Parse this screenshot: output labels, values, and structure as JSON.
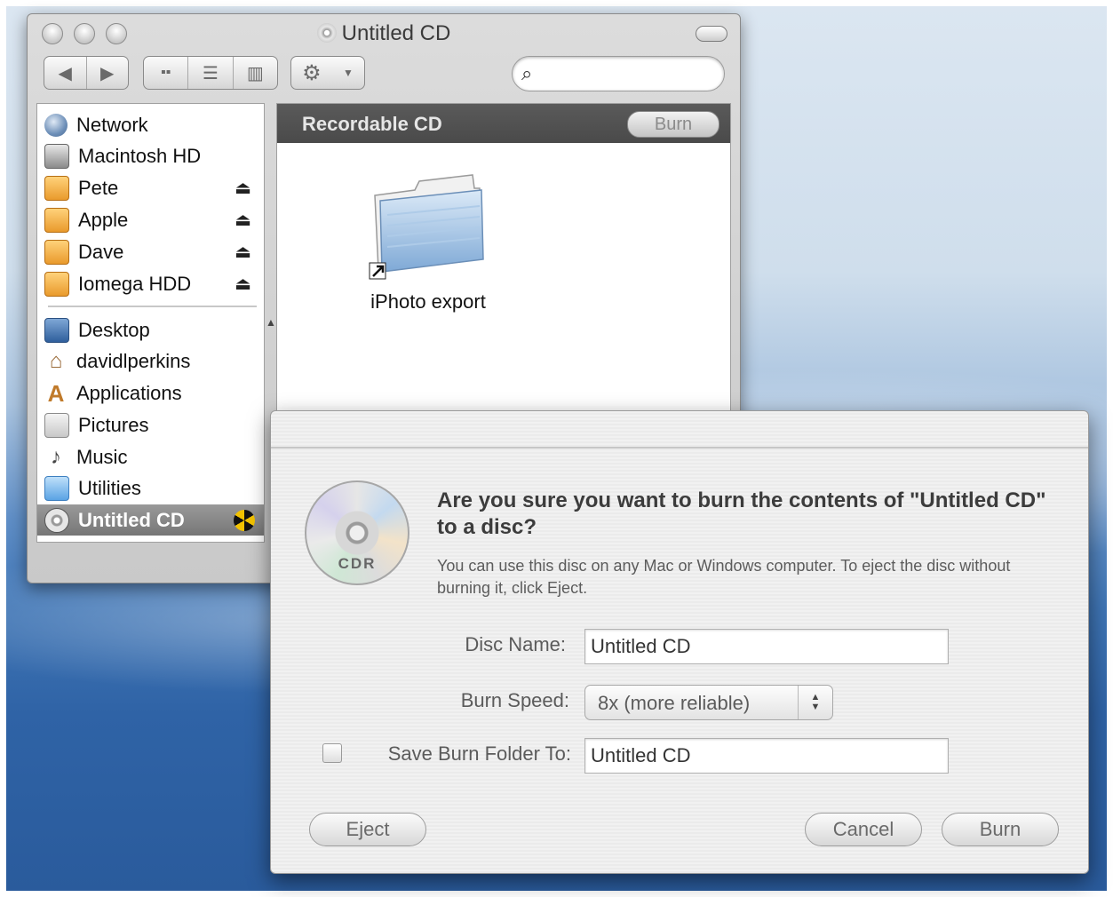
{
  "window": {
    "title": "Untitled CD",
    "search": {
      "placeholder": "",
      "value": ""
    }
  },
  "sidebar": {
    "devices": [
      {
        "label": "Network",
        "icon": "network-icon",
        "eject": false
      },
      {
        "label": "Macintosh HD",
        "icon": "hard-drive-icon",
        "eject": false
      },
      {
        "label": "Pete",
        "icon": "shared-volume-icon",
        "eject": true
      },
      {
        "label": "Apple",
        "icon": "shared-volume-icon",
        "eject": true
      },
      {
        "label": "Dave",
        "icon": "shared-volume-icon",
        "eject": true
      },
      {
        "label": "Iomega HDD",
        "icon": "shared-volume-icon",
        "eject": true
      }
    ],
    "places": [
      {
        "label": "Desktop",
        "icon": "desktop-icon"
      },
      {
        "label": "davidlperkins",
        "icon": "home-icon"
      },
      {
        "label": "Applications",
        "icon": "applications-icon"
      },
      {
        "label": "Pictures",
        "icon": "pictures-icon"
      },
      {
        "label": "Music",
        "icon": "music-icon"
      },
      {
        "label": "Utilities",
        "icon": "utilities-folder-icon"
      },
      {
        "label": "Untitled CD",
        "icon": "cd-icon",
        "selected": true
      }
    ],
    "eject_glyph": "⏏"
  },
  "content": {
    "header_label": "Recordable CD",
    "burn_label": "Burn",
    "items": [
      {
        "label": "iPhoto export",
        "icon": "folder-alias-icon"
      }
    ]
  },
  "dialog": {
    "title": "Are you sure you want to burn the contents of \"Untitled CD\" to a disc?",
    "message": "You can use this disc on any Mac or Windows computer. To eject the disc without burning it, click Eject.",
    "disc_icon_label": "CDR",
    "disc_name_label": "Disc Name:",
    "disc_name_value": "Untitled CD",
    "burn_speed_label": "Burn Speed:",
    "burn_speed_value": "8x (more reliable)",
    "save_folder_label": "Save Burn Folder To:",
    "save_folder_value": "Untitled CD",
    "save_folder_checked": false,
    "eject_label": "Eject",
    "cancel_label": "Cancel",
    "burn_label": "Burn"
  }
}
